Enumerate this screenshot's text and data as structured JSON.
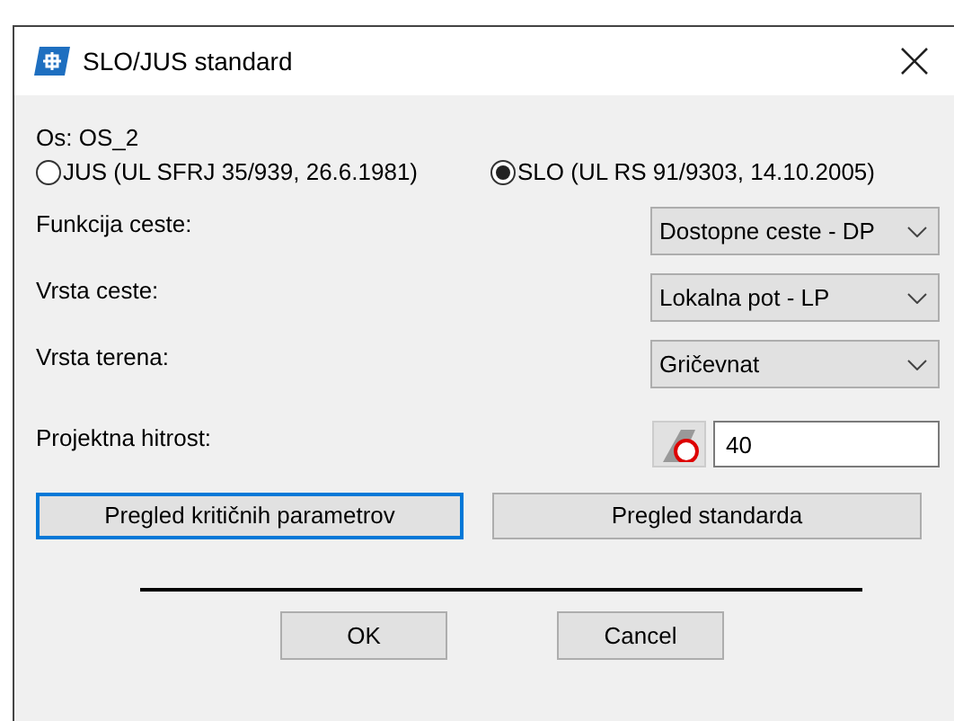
{
  "window": {
    "title": "SLO/JUS standard"
  },
  "axis_label": "Os: OS_2",
  "standards": [
    {
      "label": "JUS (UL SFRJ 35/939, 26.6.1981)",
      "selected": false
    },
    {
      "label": "SLO (UL RS 91/9303, 14.10.2005)",
      "selected": true
    }
  ],
  "fields": [
    {
      "label": "Funkcija ceste:",
      "value": "Dostopne ceste - DP"
    },
    {
      "label": "Vrsta ceste:",
      "value": "Lokalna pot - LP"
    },
    {
      "label": "Vrsta terena:",
      "value": "Gričevnat"
    }
  ],
  "design_speed": {
    "label": "Projektna hitrost:",
    "value": "40"
  },
  "actions": [
    {
      "label": "Pregled kritičnih parametrov",
      "focused": true
    },
    {
      "label": "Pregled standarda",
      "focused": false
    }
  ],
  "buttons": [
    "OK",
    "Cancel"
  ]
}
